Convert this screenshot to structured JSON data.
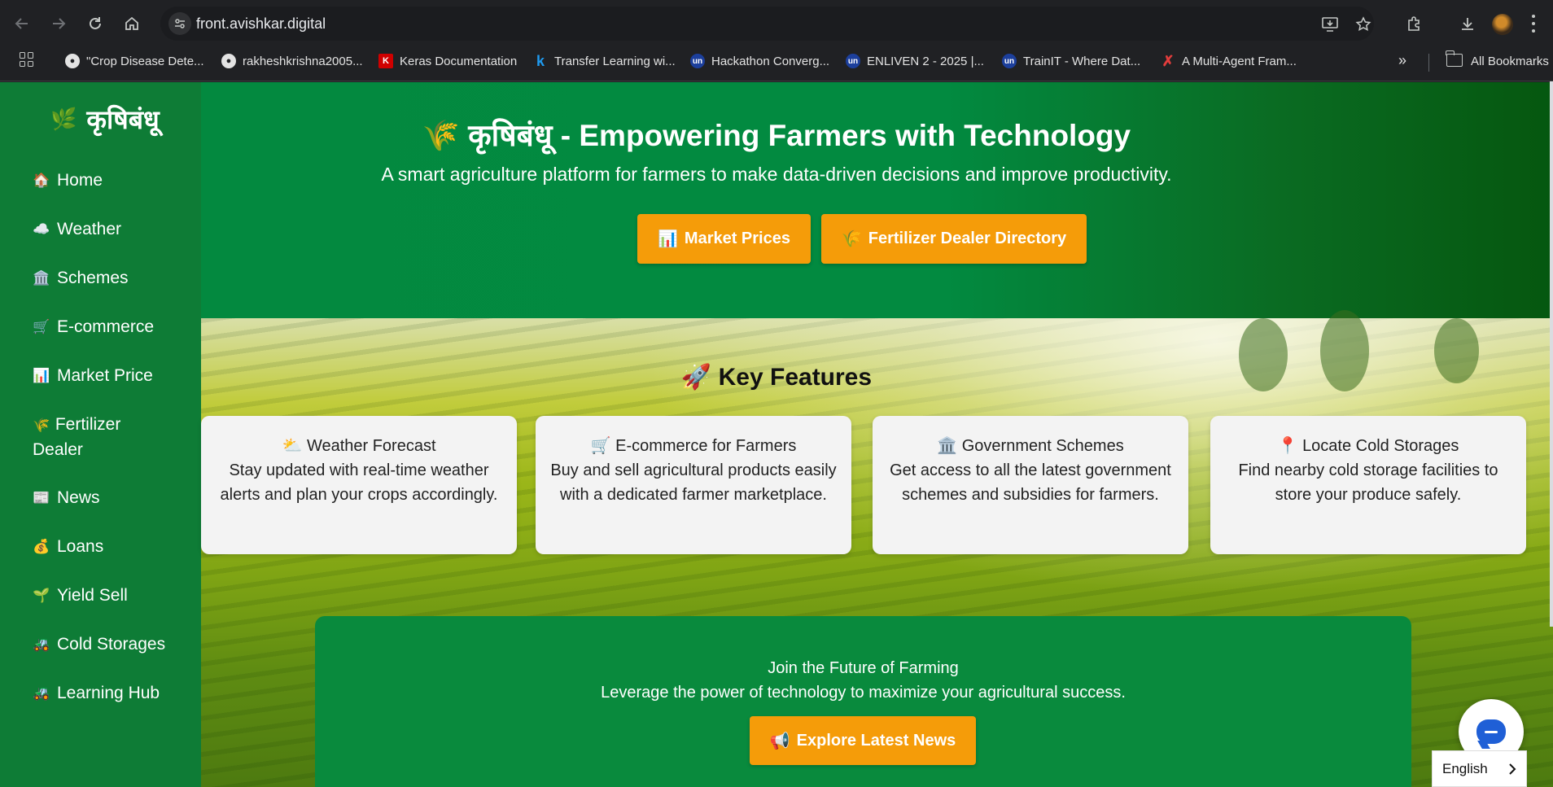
{
  "browser": {
    "url": "front.avishkar.digital",
    "bookmarks": [
      {
        "label": "\"Crop Disease Dete..."
      },
      {
        "label": "rakheshkrishna2005..."
      },
      {
        "label": "Keras Documentation"
      },
      {
        "label": "Transfer Learning wi..."
      },
      {
        "label": "Hackathon Converg..."
      },
      {
        "label": "ENLIVEN 2 - 2025 |..."
      },
      {
        "label": "TrainIT - Where Dat..."
      },
      {
        "label": "A Multi-Agent Fram..."
      }
    ],
    "all_bookmarks_label": "All Bookmarks",
    "overflow_label": "»"
  },
  "sidebar": {
    "logo": "कृषिबंधू",
    "items": [
      {
        "icon": "🏠",
        "label": "Home"
      },
      {
        "icon": "☁️",
        "label": "Weather"
      },
      {
        "icon": "🏛️",
        "label": "Schemes"
      },
      {
        "icon": "🛒",
        "label": "E-commerce"
      },
      {
        "icon": "📊",
        "label": "Market Price"
      },
      {
        "icon": "🌾",
        "label": "Fertilizer Dealer"
      },
      {
        "icon": "📰",
        "label": "News"
      },
      {
        "icon": "💰",
        "label": "Loans"
      },
      {
        "icon": "🌱",
        "label": "Yield Sell"
      },
      {
        "icon": "🚜",
        "label": "Cold Storages"
      },
      {
        "icon": "🚜",
        "label": "Learning Hub"
      }
    ]
  },
  "hero": {
    "icon": "🌾",
    "title": "कृषिबंधू - Empowering Farmers with Technology",
    "subtitle": "A smart agriculture platform for farmers to make data-driven decisions and improve productivity.",
    "buttons": [
      {
        "icon": "📊",
        "label": "Market Prices"
      },
      {
        "icon": "🌾",
        "label": "Fertilizer Dealer Directory"
      }
    ]
  },
  "features": {
    "icon": "🚀",
    "title": "Key Features",
    "cards": [
      {
        "icon": "⛅",
        "title": "Weather Forecast",
        "desc": "Stay updated with real-time weather alerts and plan your crops accordingly."
      },
      {
        "icon": "🛒",
        "title": "E-commerce for Farmers",
        "desc": "Buy and sell agricultural products easily with a dedicated farmer marketplace."
      },
      {
        "icon": "🏛️",
        "title": "Government Schemes",
        "desc": "Get access to all the latest government schemes and subsidies for farmers."
      },
      {
        "icon": "📍",
        "title": "Locate Cold Storages",
        "desc": "Find nearby cold storage facilities to store your produce safely."
      }
    ]
  },
  "join": {
    "line1": "Join the Future of Farming",
    "line2": "Leverage the power of technology to maximize your agricultural success.",
    "button_icon": "📢",
    "button_label": "Explore Latest News"
  },
  "language": {
    "selected": "English"
  },
  "colors": {
    "sidebar": "#0e7c36",
    "hero": "#028a40",
    "accent_button": "#f59c09",
    "join_panel": "#098a3d",
    "browser_chrome": "#202124"
  }
}
